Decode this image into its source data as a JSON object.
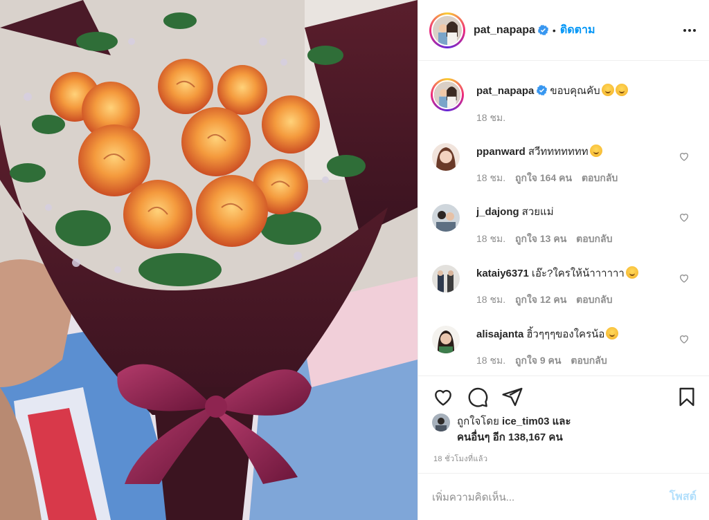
{
  "post": {
    "author": "pat_napapa",
    "follow_label": "ติดตาม",
    "caption_text": "ขอบคุณคับ",
    "caption_time": "18 ชม."
  },
  "comments": [
    {
      "username": "ppanward",
      "text": "สวีททททททท",
      "time": "18 ชม.",
      "likes": "ถูกใจ 164 คน",
      "reply": "ตอบกลับ"
    },
    {
      "username": "j_dajong",
      "text": "สวยแม่",
      "time": "18 ชม.",
      "likes": "ถูกใจ 13 คน",
      "reply": "ตอบกลับ"
    },
    {
      "username": "kataiy6371",
      "text": "เอ๊ะ?ใครให้น้าาาาาา",
      "time": "18 ชม.",
      "likes": "ถูกใจ 12 คน",
      "reply": "ตอบกลับ"
    },
    {
      "username": "alisajanta",
      "text": "ฮิ้วๆๆๆของใครน้อ",
      "time": "18 ชม.",
      "likes": "ถูกใจ 9 คน",
      "reply": "ตอบกลับ"
    }
  ],
  "likes_summary": {
    "line1_prefix": "ถูกใจโดย",
    "liker": "ice_tim03",
    "line1_suffix": "และ",
    "line2": "คนอื่นๆ อีก 138,167 คน"
  },
  "time_ago": "18 ชั่วโมงที่แล้ว",
  "composer": {
    "placeholder": "เพิ่มความคิดเห็น...",
    "post_label": "โพสต์"
  },
  "icons": {
    "like": "heart-icon",
    "comment": "comment-icon",
    "share": "share-icon",
    "save": "bookmark-icon",
    "more": "more-options-icon",
    "verified": "verified-badge-icon"
  },
  "colors": {
    "link_blue": "#0095f6",
    "post_disabled": "#b2dffc",
    "muted_text": "#8e8e8e",
    "verified_blue": "#3897f0"
  }
}
